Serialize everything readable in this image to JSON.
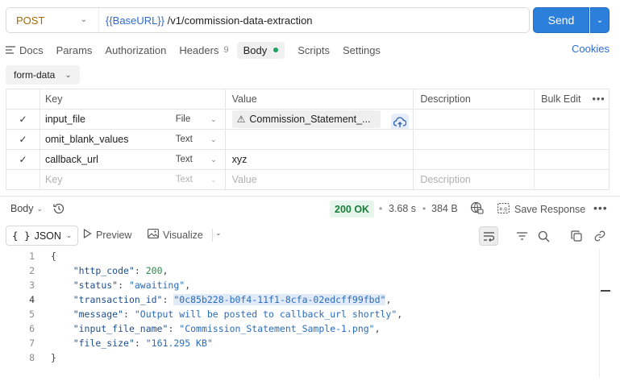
{
  "request": {
    "method": "POST",
    "url_var": "{{BaseURL}}",
    "url_path": " /v1/commission-data-extraction",
    "send_label": "Send"
  },
  "tabs": [
    {
      "label": "Docs"
    },
    {
      "label": "Params"
    },
    {
      "label": "Authorization"
    },
    {
      "label": "Headers",
      "count": "9"
    },
    {
      "label": "Body"
    },
    {
      "label": "Scripts"
    },
    {
      "label": "Settings"
    }
  ],
  "cookies_label": "Cookies",
  "body_mode": "form-data",
  "table": {
    "headers": {
      "key": "Key",
      "value": "Value",
      "description": "Description",
      "bulk_edit": "Bulk Edit"
    },
    "rows": [
      {
        "key": "input_file",
        "type": "File",
        "value": "Commission_Statement_..."
      },
      {
        "key": "omit_blank_values",
        "type": "Text",
        "value": ""
      },
      {
        "key": "callback_url",
        "type": "Text",
        "value": "xyz"
      }
    ],
    "placeholder": {
      "key": "Key",
      "type": "Text",
      "value": "Value",
      "description": "Description"
    }
  },
  "response": {
    "body_label": "Body",
    "status": "200 OK",
    "time": "3.68 s",
    "size": "384 B",
    "save_label": "Save Response"
  },
  "viewer": {
    "format": "JSON",
    "preview": "Preview",
    "visualize": "Visualize"
  },
  "code_lines": [
    {
      "n": "1",
      "text": "{"
    },
    {
      "n": "2",
      "key": "\"http_code\"",
      "val": "200",
      "type": "num",
      "comma": ","
    },
    {
      "n": "3",
      "key": "\"status\"",
      "val": "\"awaiting\"",
      "type": "str",
      "comma": ","
    },
    {
      "n": "4",
      "key": "\"transaction_id\"",
      "val": "\"0c85b228-b0f4-11f1-8cfa-02edcff99fbd\"",
      "type": "str",
      "comma": ",",
      "current": true
    },
    {
      "n": "5",
      "key": "\"message\"",
      "val": "\"Output will be posted to callback_url shortly\"",
      "type": "str",
      "comma": ","
    },
    {
      "n": "6",
      "key": "\"input_file_name\"",
      "val": "\"Commission_Statement_Sample-1.png\"",
      "type": "str",
      "comma": ","
    },
    {
      "n": "7",
      "key": "\"file_size\"",
      "val": "\"161.295 KB\"",
      "type": "str",
      "comma": ""
    },
    {
      "n": "8",
      "text": "}"
    }
  ],
  "colors": {
    "accent": "#2d7fdc",
    "ok": "#1a7d3a",
    "method": "#a16b00"
  }
}
